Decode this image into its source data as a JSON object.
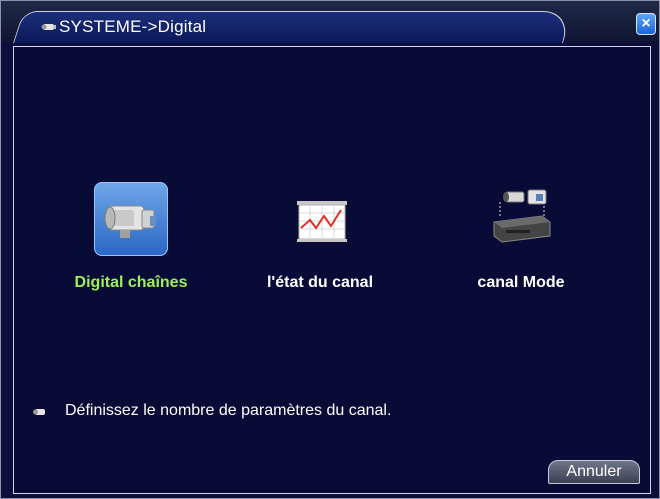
{
  "window": {
    "title": "SYSTEME->Digital",
    "close_symbol": "×"
  },
  "items": [
    {
      "label": "Digital chaînes",
      "icon": "camera-icon",
      "selected": true
    },
    {
      "label": "l'état du canal",
      "icon": "chart-icon",
      "selected": false
    },
    {
      "label": "canal Mode",
      "icon": "dvr-cameras-icon",
      "selected": false
    }
  ],
  "hint": {
    "text": "Définissez le nombre de paramètres du canal.",
    "icon": "camera-small-icon"
  },
  "buttons": {
    "cancel_label": "Annuler"
  },
  "colors": {
    "background": "#080b36",
    "selected_label": "#9cf05a",
    "text": "#ffffff",
    "title_tab": "#1a2f78",
    "close_button": "#2f7ae8"
  }
}
